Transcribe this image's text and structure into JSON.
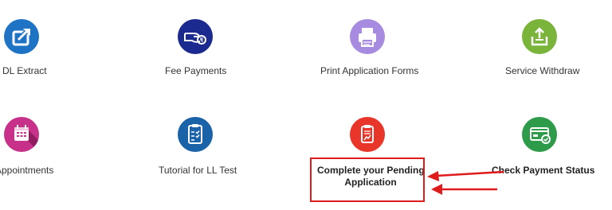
{
  "services": [
    {
      "label": "DL Extract",
      "icon": "share-box-icon",
      "color": "#1f73c4"
    },
    {
      "label": "Fee Payments",
      "icon": "hand-rupee-icon",
      "color": "#1b2a8f"
    },
    {
      "label": "Print Application Forms",
      "icon": "printer-icon",
      "color": "#a78be0"
    },
    {
      "label": "Service Withdraw",
      "icon": "tray-upload-icon",
      "color": "#7ab43a"
    },
    {
      "label": "Appointments",
      "icon": "calendar-icon",
      "color": "#c7318a"
    },
    {
      "label": "Tutorial for LL Test",
      "icon": "clipboard-check-icon",
      "color": "#1b63a8"
    },
    {
      "label": "Complete your Pending Application",
      "line1": "Complete your Pending",
      "line2": "Application",
      "icon": "clipboard-chart-icon",
      "color": "#e8362a"
    },
    {
      "label": "Check Payment Status",
      "icon": "card-check-icon",
      "color": "#2e9b4a"
    }
  ],
  "annotation": {
    "color": "#e01b1b"
  }
}
